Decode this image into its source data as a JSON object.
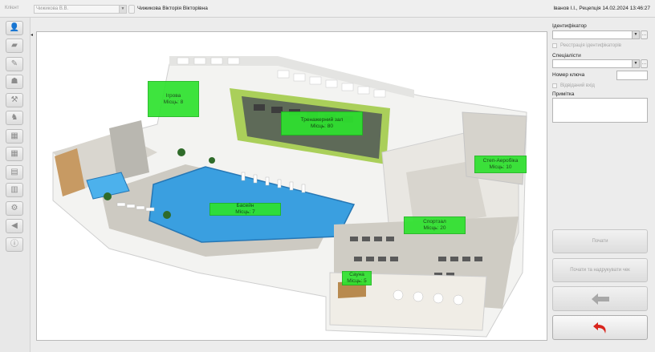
{
  "topbar": {
    "client_label": "Клієнт",
    "client_select_value": "Чижикова В.В.",
    "client_name": "Чижикова Вікторія Вікторівна",
    "user_info": "Іванов І.І., Рецепція   14.02.2024 13:46:27"
  },
  "sidebar": {
    "buttons": [
      "client-icon",
      "folder-icon",
      "edit-icon",
      "group-icon",
      "tools-icon",
      "fitness-icon",
      "calendar-icon",
      "calendar-grid-icon",
      "schedule-icon",
      "list-icon",
      "settings-icon",
      "notify-icon",
      "info-icon"
    ]
  },
  "plan": {
    "zones": [
      {
        "name": "Ігрова",
        "places": "Місць: 8"
      },
      {
        "name": "Тренажерний зал",
        "places": "Місць: 80"
      },
      {
        "name": "Степ-Аеробіка",
        "places": "Місць: 10"
      },
      {
        "name": "Басейн",
        "places": "Місць: 7"
      },
      {
        "name": "Спортзал",
        "places": "Місць: 20"
      },
      {
        "name": "Сауна",
        "places": "Місць: 5"
      }
    ],
    "colors": {
      "zone": "#2ee22e",
      "pool": "#3a9fe0"
    }
  },
  "right_panel": {
    "identifier_label": "Ідентифікатор",
    "register_identifiers_label": "Реєстрація ідентифікаторів",
    "specialists_label": "Спеціалісти",
    "key_number_label": "Номер ключа",
    "visited_label": "Відвіданий вхід",
    "note_label": "Примітка",
    "start_button": "Почати",
    "start_print_button": "Почати та надрукувати чек",
    "back_icon": "arrow-left-icon",
    "undo_icon": "undo-arrow-icon"
  }
}
